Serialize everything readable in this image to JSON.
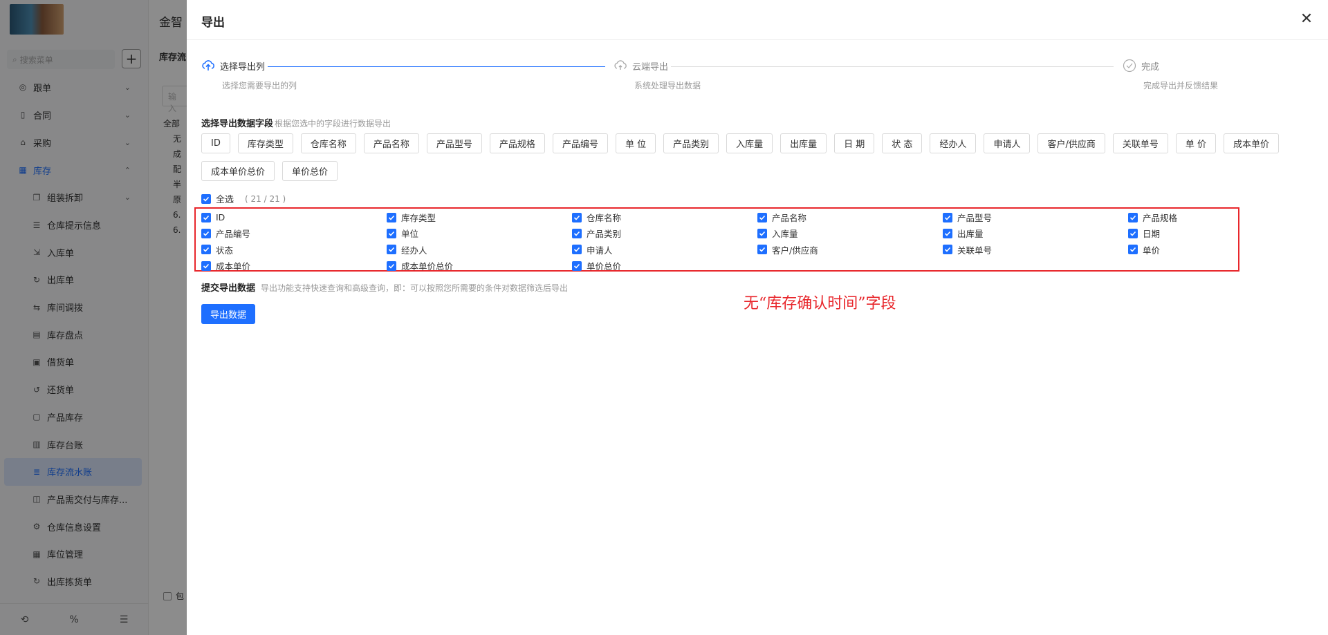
{
  "background": {
    "topbar_title": "金智",
    "page_header": "库存流",
    "input_placeholder": "输入",
    "tree_items": [
      "全部",
      "无",
      "成",
      "配",
      "半",
      "原",
      "6.",
      "6."
    ],
    "bottom_check": "包",
    "sidebar": {
      "search_placeholder": "搜索菜单",
      "add_label": "+",
      "menu": [
        {
          "label": "跟单",
          "icon": "target-icon",
          "chevron": "⌄"
        },
        {
          "label": "合同",
          "icon": "contract-icon",
          "chevron": "⌄"
        },
        {
          "label": "采购",
          "icon": "purchase-icon",
          "chevron": "⌄"
        },
        {
          "label": "库存",
          "icon": "warehouse-icon",
          "chevron": "⌃"
        }
      ],
      "submenu": [
        {
          "label": "组装拆卸",
          "icon": "assemble-icon",
          "chevron": "⌄"
        },
        {
          "label": "仓库提示信息",
          "icon": "list-icon"
        },
        {
          "label": "入库单",
          "icon": "inbound-icon"
        },
        {
          "label": "出库单",
          "icon": "outbound-icon"
        },
        {
          "label": "库间调拨",
          "icon": "transfer-icon"
        },
        {
          "label": "库存盘点",
          "icon": "inventory-icon"
        },
        {
          "label": "借货单",
          "icon": "borrow-icon"
        },
        {
          "label": "还货单",
          "icon": "return-icon"
        },
        {
          "label": "产品库存",
          "icon": "doc-icon"
        },
        {
          "label": "库存台账",
          "icon": "ledger-icon"
        },
        {
          "label": "库存流水账",
          "icon": "flow-icon",
          "active": true
        },
        {
          "label": "产品需交付与库存...",
          "icon": "book-icon"
        },
        {
          "label": "仓库信息设置",
          "icon": "settings-icon"
        },
        {
          "label": "库位管理",
          "icon": "grid-icon"
        },
        {
          "label": "出库拣货单",
          "icon": "pick-icon"
        }
      ],
      "bottom_icons": [
        "history-icon",
        "percent-icon",
        "collapse-icon"
      ],
      "bottom_glyphs": [
        "⟲",
        "%",
        "☰"
      ]
    }
  },
  "drawer": {
    "title": "导出",
    "close_glyph": "✕",
    "steps": [
      {
        "title": "选择导出列",
        "desc": "选择您需要导出的列"
      },
      {
        "title": "云端导出",
        "desc": "系统处理导出数据"
      },
      {
        "title": "完成",
        "desc": "完成导出并反馈结果"
      }
    ],
    "field_section": {
      "title": "选择导出数据字段",
      "hint": "根据您选中的字段进行数据导出"
    },
    "tags": [
      "ID",
      "库存类型",
      "仓库名称",
      "产品名称",
      "产品型号",
      "产品规格",
      "产品编号",
      "单 位",
      "产品类别",
      "入库量",
      "出库量",
      "日 期",
      "状 态",
      "经办人",
      "申请人",
      "客户/供应商",
      "关联单号",
      "单 价",
      "成本单价",
      "成本单价总价",
      "单价总价"
    ],
    "select_all": {
      "label": "全选",
      "count": "( 21 / 21 )"
    },
    "checked_fields": [
      "ID",
      "库存类型",
      "仓库名称",
      "产品名称",
      "产品型号",
      "产品规格",
      "产品编号",
      "单位",
      "产品类别",
      "入库量",
      "出库量",
      "日期",
      "状态",
      "经办人",
      "申请人",
      "客户/供应商",
      "关联单号",
      "单价",
      "成本单价",
      "成本单价总价",
      "单价总价"
    ],
    "submit_section": {
      "title": "提交导出数据",
      "hint": "导出功能支持快速查询和高级查询，即：可以按照您所需要的条件对数据筛选后导出"
    },
    "export_button": "导出数据",
    "annotation": "无“库存确认时间”字段"
  },
  "colors": {
    "primary": "#1e6fff",
    "annotation_red": "#e8262b"
  }
}
